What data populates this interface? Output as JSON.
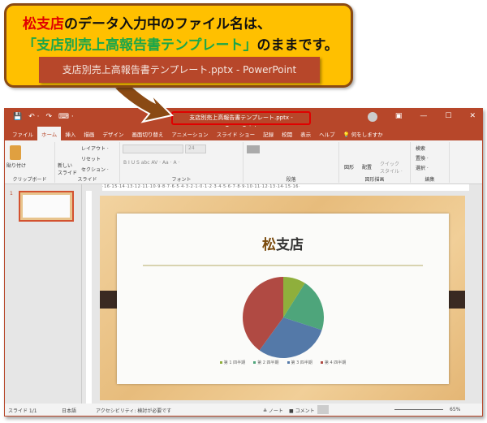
{
  "callout": {
    "line1_red": "松支店",
    "line1_rest": "のデータ入力中のファイル名は、",
    "line2_green": "「支店別売上高報告書テンプレート」",
    "line2_rest": "のままです。",
    "title_bar": "支店別売上高報告書テンプレート.pptx  -  PowerPoint"
  },
  "window": {
    "title": "支店別売上高報告書テンプレート.pptx  -  PowerPoint",
    "qa": [
      "💾",
      "↶ ·",
      "↷",
      "⌨ ·"
    ],
    "controls": [
      "▣",
      "—",
      "☐",
      "✕"
    ]
  },
  "tabs": [
    "ファイル",
    "ホーム",
    "挿入",
    "描画",
    "デザイン",
    "画面切り替え",
    "アニメーション",
    "スライド ショー",
    "記録",
    "校閲",
    "表示",
    "ヘルプ",
    "💡 何をしますか"
  ],
  "active_tab": "ホーム",
  "ribbon": {
    "clipboard": {
      "label": "クリップボード",
      "paste": "貼り付け"
    },
    "slides": {
      "label": "スライド",
      "new": "新しい スライド",
      "layout": "レイアウト ·",
      "reset": "リセット",
      "section": "セクション ·"
    },
    "font": {
      "label": "フォント",
      "size": "24",
      "buttons": "B  I  U  S  abc  AV ·  Aa ·  A ·"
    },
    "paragraph": {
      "label": "段落"
    },
    "drawing": {
      "label": "図形描画",
      "shape": "図形",
      "arrange": "配置",
      "quick": "クイック スタイル ·"
    },
    "edit": {
      "label": "編集",
      "find": "検索",
      "replace": "置換 ·",
      "select": "選択 ·"
    }
  },
  "ruler": "·16·15·14·13·12·11·10·9·8·7·6·5·4·3·2·1·0·1·2·3·4·5·6·7·8·9·10·11·12·13·14·15·16·",
  "thumb_number": "1",
  "slide": {
    "title_brown": "松",
    "title_rest": "支店"
  },
  "chart_data": {
    "type": "pie",
    "categories": [
      "第 1 四半期",
      "第 2 四半期",
      "第 3 四半期",
      "第 4 四半期"
    ],
    "values": [
      9,
      21,
      30,
      40
    ],
    "colors": [
      "#8faf3c",
      "#4ea57b",
      "#5479a8",
      "#b04a43"
    ],
    "legend": "bottom"
  },
  "status": {
    "slide": "スライド 1/1",
    "lang": "日本語",
    "access": "アクセシビリティ: 検討が必要です",
    "notes": "≜ ノート",
    "comments": "■ コメント",
    "zoom": "65%"
  }
}
